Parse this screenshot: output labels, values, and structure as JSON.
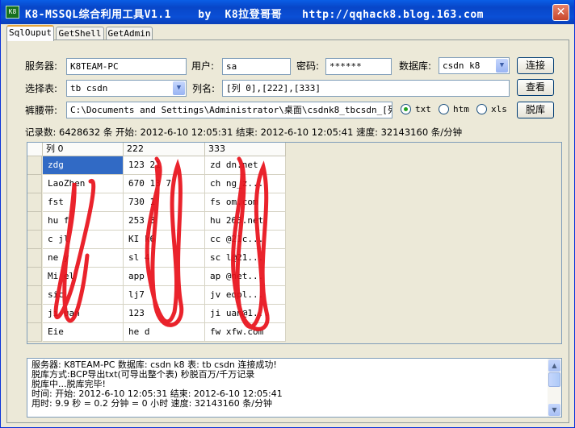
{
  "window": {
    "title": "K8-MSSQL综合利用工具V1.1    by  K8拉登哥哥   http://qqhack8.blog.163.com",
    "icon_text": "K8",
    "close_glyph": "✕"
  },
  "tabs": [
    {
      "label": "SqlOuput",
      "active": true
    },
    {
      "label": "GetShell",
      "active": false
    },
    {
      "label": "GetAdmin",
      "active": false
    }
  ],
  "form": {
    "server_label": "服务器:",
    "server_value": "K8TEAM-PC",
    "user_label": "用户:",
    "user_value": "sa",
    "password_label": "密码:",
    "password_value": "******",
    "database_label": "数据库:",
    "database_value": "csdn k8",
    "table_label": "选择表:",
    "table_value": "tb  csdn",
    "column_label": "列名:",
    "column_value": "[列 0],[222],[333]",
    "path_label": "裤腰带:",
    "path_value": "C:\\Documents and Settings\\Administrator\\桌面\\csdnk8_tbcsdn_[列0][2",
    "format_options": [
      {
        "label": "txt",
        "checked": true
      },
      {
        "label": "htm",
        "checked": false
      },
      {
        "label": "xls",
        "checked": false
      }
    ],
    "connect_button": "连接",
    "view_button": "查看",
    "dump_button": "脱库"
  },
  "status_line": "记录数: 6428632 条 开始: 2012-6-10 12:05:31 结束: 2012-6-10 12:05:41 速度: 32143160 条/分钟",
  "grid": {
    "columns": [
      "列 0",
      "222",
      "333"
    ],
    "rows": [
      [
        "zdg",
        "123  21",
        "zd  dn.net"
      ],
      [
        "LaoZhen",
        "670  13  7",
        "ch  ng_z..."
      ],
      [
        "fst",
        "730  1",
        "fs  om.com"
      ],
      [
        "hu  f",
        "253  3",
        "hu  263.net"
      ],
      [
        "c  jl",
        "KI  k6",
        "cc  @21c..."
      ],
      [
        "ne  y",
        "sl  4",
        "sc  l@21..."
      ],
      [
        "Mi  el",
        "app",
        "ap  @net..."
      ],
      [
        "sic",
        "lj7",
        "jv  eopl..."
      ],
      [
        "ji  uan",
        "123",
        "ji  uan@1..."
      ],
      [
        "Eie",
        "he  d",
        "fw  xfw.com"
      ]
    ]
  },
  "log": [
    "服务器: K8TEAM-PC 数据库: csdn k8 表: tb  csdn 连接成功!",
    "脱库方式:BCP导出txt(可导出整个表) 秒脱百万/千万记录",
    "脱库中...脱库完毕!",
    "时间: 开始: 2012-6-10 12:05:31 结束: 2012-6-10 12:05:41",
    "用时: 9.9 秒 = 0.2 分钟 = 0 小时  速度: 32143160 条/分钟"
  ]
}
